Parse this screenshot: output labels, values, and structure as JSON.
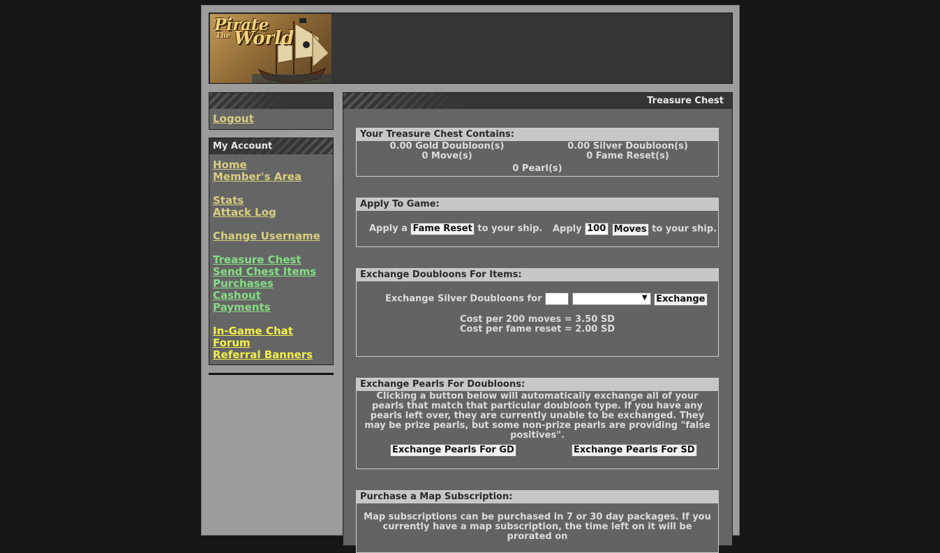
{
  "logo": {
    "line1": "Pirate",
    "small": "The",
    "line2": "World"
  },
  "sidebar": {
    "logout": "Logout",
    "account_title": "My Account",
    "links_a": [
      "Home",
      "Member's Area"
    ],
    "links_b": [
      "Stats",
      "Attack Log"
    ],
    "links_c": [
      "Change Username"
    ],
    "links_d": [
      "Treasure Chest",
      "Send Chest Items",
      "Purchases",
      "Cashout",
      "Payments"
    ],
    "links_e": [
      "In-Game Chat",
      "Forum",
      "Referral Banners"
    ]
  },
  "main": {
    "title": "Treasure Chest",
    "contains": {
      "heading": "Your Treasure Chest Contains:",
      "gold": "0.00 Gold Doubloon(s)",
      "silver": "0.00 Silver Doubloon(s)",
      "moves": "0 Move(s)",
      "fame": "0 Fame Reset(s)",
      "pearls": "0 Pearl(s)"
    },
    "apply": {
      "heading": "Apply To Game:",
      "apply_a": "Apply a",
      "fame_button": "Fame Reset",
      "to_ship_1": "to your ship.",
      "apply_label": "Apply",
      "moves_value": "100",
      "moves_button": "Moves",
      "to_ship_2": "to your ship."
    },
    "exchange": {
      "heading": "Exchange Doubloons For Items:",
      "label": "Exchange Silver Doubloons for",
      "button": "Exchange",
      "cost_moves": "Cost per 200 moves = 3.50 SD",
      "cost_fame": "Cost per fame reset = 2.00 SD"
    },
    "pearls": {
      "heading": "Exchange Pearls For Doubloons:",
      "desc": "Clicking a button below will automatically exchange all of your pearls that match that particular doubloon type. If you have any pearls left over, they are currently unable to be exchanged. They may be prize pearls, but some non-prize pearls are providing \"false positives\".",
      "btn_gd": "Exchange Pearls For GD",
      "btn_sd": "Exchange Pearls For SD"
    },
    "map": {
      "heading": "Purchase a Map Subscription:",
      "desc": "Map subscriptions can be purchased in 7 or 30 day packages. If you currently have a map subscription, the time left on it will be prorated on"
    }
  }
}
